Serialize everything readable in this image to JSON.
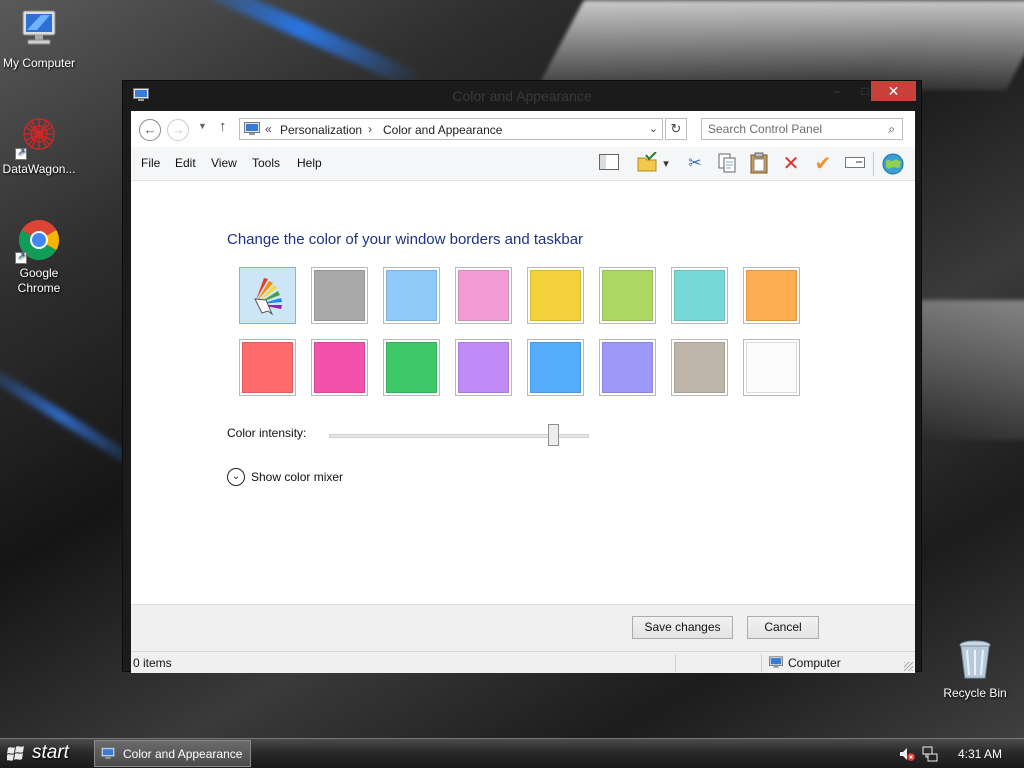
{
  "desktop": {
    "icons": [
      {
        "label": "My Computer"
      },
      {
        "label": "DataWagon..."
      },
      {
        "label": "Google Chrome"
      },
      {
        "label": "Recycle Bin"
      }
    ]
  },
  "window": {
    "title": "Color and Appearance",
    "controls": {
      "minimize": "–",
      "maximize": "□",
      "close": "✕"
    }
  },
  "address": {
    "prefix": "«",
    "breadcrumbs": [
      "Personalization",
      "Color and Appearance"
    ],
    "separator": "›",
    "dropdown": "⌄",
    "refresh": "↻"
  },
  "nav": {
    "back": "←",
    "forward": "→",
    "recent": "▼",
    "up": "↑"
  },
  "search": {
    "placeholder": "Search Control Panel",
    "icon": "⌕"
  },
  "menu": [
    "File",
    "Edit",
    "View",
    "Tools",
    "Help"
  ],
  "toolbar": {
    "icons": [
      "layout-icon",
      "folder-check-icon",
      "cut-icon",
      "copy-icon",
      "paste-icon",
      "delete-icon",
      "properties-icon",
      "rename-icon",
      "globe-icon"
    ],
    "glyphs": {
      "dropdown": "▾",
      "cut": "✂",
      "delete": "✕",
      "properties": "✔"
    }
  },
  "content": {
    "heading": "Change the color of your window borders and taskbar",
    "swatches": [
      {
        "name": "automatic",
        "color": "",
        "selected": true
      },
      {
        "name": "gray",
        "color": "#a9a9a9"
      },
      {
        "name": "light-blue",
        "color": "#8fcafa"
      },
      {
        "name": "pink",
        "color": "#f39bd4"
      },
      {
        "name": "yellow",
        "color": "#f3d13a"
      },
      {
        "name": "lime",
        "color": "#abd863"
      },
      {
        "name": "teal",
        "color": "#77d8d8"
      },
      {
        "name": "orange",
        "color": "#fdac4f"
      },
      {
        "name": "red",
        "color": "#fd6b6b"
      },
      {
        "name": "magenta",
        "color": "#f252ab"
      },
      {
        "name": "green",
        "color": "#3ec769"
      },
      {
        "name": "purple",
        "color": "#c18bf7"
      },
      {
        "name": "blue",
        "color": "#55acfc"
      },
      {
        "name": "periwinkle",
        "color": "#9c99fa"
      },
      {
        "name": "taupe",
        "color": "#c0b5aa"
      },
      {
        "name": "white",
        "color": "#fbfbfb"
      }
    ],
    "intensity_label": "Color intensity:",
    "intensity_value": 0.86,
    "mixer_label": "Show color mixer",
    "mixer_icon": "⌄"
  },
  "buttons": {
    "save": "Save changes",
    "cancel": "Cancel"
  },
  "status": {
    "items": "0 items",
    "location": "Computer"
  },
  "taskbar": {
    "start": "start",
    "task_label": "Color and Appearance",
    "clock": "4:31 AM"
  }
}
